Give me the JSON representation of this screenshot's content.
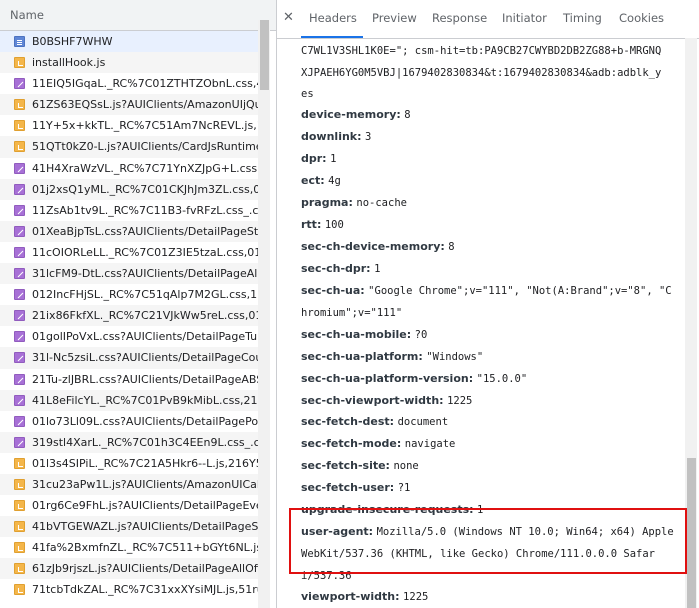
{
  "left": {
    "column_header": "Name",
    "files": [
      {
        "name": "B0BSHF7WHW",
        "type": "doc"
      },
      {
        "name": "installHook.js",
        "type": "js"
      },
      {
        "name": "11EIQ5IGqaL._RC%7C01ZTHTZObnL.css,41",
        "type": "css"
      },
      {
        "name": "61ZS63EQSsL.js?AUIClients/AmazonUIjQue",
        "type": "js"
      },
      {
        "name": "11Y+5x+kkTL._RC%7C51Am7NcREVL.js,11y",
        "type": "js"
      },
      {
        "name": "51QTt0kZ0-L.js?AUIClients/CardJsRuntimeE",
        "type": "js"
      },
      {
        "name": "41H4XraWzVL._RC%7C71YnXZJpG+L.css,41",
        "type": "css"
      },
      {
        "name": "01j2xsQ1yML._RC%7C01CKJhJm3ZL.css,01.",
        "type": "css"
      },
      {
        "name": "11ZsAb1tv9L._RC%7C11B3-fvRFzL.css_.css?",
        "type": "css"
      },
      {
        "name": "01XeaBjpTsL.css?AUIClients/DetailPageStor",
        "type": "css"
      },
      {
        "name": "11cOIORLeLL._RC%7C01Z3IE5tzaL.css,01ng",
        "type": "css"
      },
      {
        "name": "31lcFM9-DtL.css?AUIClients/DetailPageAll..",
        "type": "css"
      },
      {
        "name": "012IncFHjSL._RC%7C51qAlp7M2GL.css,11g",
        "type": "css"
      },
      {
        "name": "21ix86FkfXL._RC%7C21VJkWw5reL.css,01Bc",
        "type": "css"
      },
      {
        "name": "01golIPoVxL.css?AUIClients/DetailPageTurb",
        "type": "css"
      },
      {
        "name": "31l-Nc5zsiL.css?AUIClients/DetailPageCoup",
        "type": "css"
      },
      {
        "name": "21Tu-zlJBRL.css?AUIClients/DetailPageABS.",
        "type": "css"
      },
      {
        "name": "41L8eFilcYL._RC%7C01PvB9kMibL.css,21pN",
        "type": "css"
      },
      {
        "name": "01lo73Ll09L.css?AUIClients/DetailPagePost",
        "type": "css"
      },
      {
        "name": "319stl4XarL._RC%7C01h3C4EEn9L.css_.css?",
        "type": "css"
      },
      {
        "name": "01l3s4SIPiL._RC%7C21A5Hkr6--L.js,216Y5Jc",
        "type": "js"
      },
      {
        "name": "31cu23aPw1L.js?AUIClients/AmazonUICale",
        "type": "js"
      },
      {
        "name": "01rg6Ce9FhL.js?AUIClients/DetailPageEver",
        "type": "js"
      },
      {
        "name": "41bVTGEWAZL.js?AUIClients/DetailPageStc",
        "type": "js"
      },
      {
        "name": "41fa%2BxmfnZL._RC%7C511+bGYt6NL.js,0",
        "type": "js"
      },
      {
        "name": "61zJb9rjszL.js?AUIClients/DetailPageAllOffe",
        "type": "js"
      },
      {
        "name": "71tcbTdkZAL._RC%7C31xxXYsiMJL.js,51ruf",
        "type": "js"
      }
    ]
  },
  "tabs": [
    "Headers",
    "Preview",
    "Response",
    "Initiator",
    "Timing",
    "Cookies"
  ],
  "active_tab": "Headers",
  "headers": [
    {
      "name": "",
      "value": "C7WL1V3SHL1K0E=\"; csm-hit=tb:PA9CB27CWYBD2DB2ZG88+b-MRGNQ"
    },
    {
      "name": "",
      "value": "XJPAEH6YG0M5VBJ|1679402830834&t:1679402830834&adb:adblk_y"
    },
    {
      "name": "",
      "value": "es"
    },
    {
      "name": "device-memory:",
      "value": "8"
    },
    {
      "name": "downlink:",
      "value": "3"
    },
    {
      "name": "dpr:",
      "value": "1"
    },
    {
      "name": "ect:",
      "value": "4g"
    },
    {
      "name": "pragma:",
      "value": "no-cache"
    },
    {
      "name": "rtt:",
      "value": "100"
    },
    {
      "name": "sec-ch-device-memory:",
      "value": "8"
    },
    {
      "name": "sec-ch-dpr:",
      "value": "1"
    },
    {
      "name": "sec-ch-ua:",
      "value": "\"Google Chrome\";v=\"111\", \"Not(A:Brand\";v=\"8\", \"C"
    },
    {
      "name": "",
      "value": "hromium\";v=\"111\""
    },
    {
      "name": "sec-ch-ua-mobile:",
      "value": "?0"
    },
    {
      "name": "sec-ch-ua-platform:",
      "value": "\"Windows\""
    },
    {
      "name": "sec-ch-ua-platform-version:",
      "value": "\"15.0.0\""
    },
    {
      "name": "sec-ch-viewport-width:",
      "value": "1225"
    },
    {
      "name": "sec-fetch-dest:",
      "value": "document"
    },
    {
      "name": "sec-fetch-mode:",
      "value": "navigate"
    },
    {
      "name": "sec-fetch-site:",
      "value": "none"
    },
    {
      "name": "sec-fetch-user:",
      "value": "?1"
    },
    {
      "name": "upgrade-insecure-requests:",
      "value": "1"
    },
    {
      "name": "user-agent:",
      "value": "Mozilla/5.0 (Windows NT 10.0; Win64; x64) Apple"
    },
    {
      "name": "",
      "value": "WebKit/537.36 (KHTML, like Gecko) Chrome/111.0.0.0 Safar"
    },
    {
      "name": "",
      "value": "i/537.36"
    },
    {
      "name": "viewport-width:",
      "value": "1225"
    }
  ],
  "colors": {
    "accent": "#1a73e8",
    "highlight": "#e01010",
    "selected_row": "#e8f0fe"
  }
}
